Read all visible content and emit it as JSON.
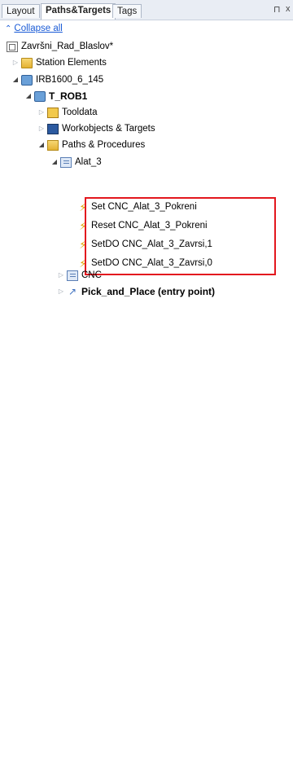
{
  "tabs": [
    {
      "label": "Layout",
      "active": false
    },
    {
      "label": "Paths&Targets",
      "active": true
    },
    {
      "label": "Tags",
      "active": false
    }
  ],
  "tab_controls": {
    "pin": "⊓",
    "close": "x"
  },
  "collapse_all": "Collapse all",
  "tree": {
    "station": "Završni_Rad_Blaslov*",
    "station_elements": "Station Elements",
    "robot": "IRB1600_6_145",
    "task": "T_ROB1",
    "tooldata": "Tooldata",
    "workobjects": "Workobjects & Targets",
    "paths": "Paths & Procedures",
    "alat3": "Alat_3",
    "instructions": [
      "Set CNC_Alat_3_Pokreni",
      "Reset CNC_Alat_3_Pokreni",
      "SetDO CNC_Alat_3_Zavrsi,1",
      "SetDO CNC_Alat_3_Zavrsi,0"
    ],
    "cnc": "CNC",
    "pick_and_place": "Pick_and_Place (entry point)"
  },
  "colors": {
    "highlight": "#e3171e",
    "link": "#1a5bd6"
  }
}
